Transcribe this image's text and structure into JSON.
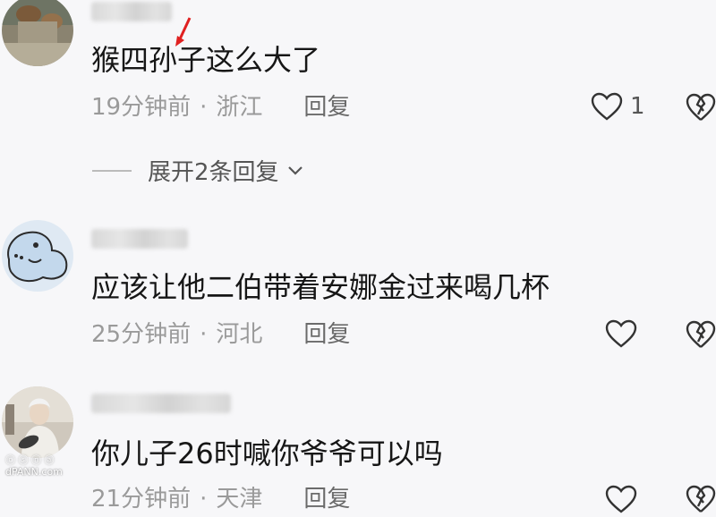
{
  "comments": [
    {
      "text": "猴四孙子这么大了",
      "time": "19分钟前",
      "separator": "·",
      "region": "浙江",
      "reply_label": "回复",
      "like_count": "1",
      "expand_label": "展开2条回复"
    },
    {
      "text": "应该让他二伯带着安娜金过来喝几杯",
      "time": "25分钟前",
      "separator": "·",
      "region": "河北",
      "reply_label": "回复"
    },
    {
      "text": "你儿子26时喊你爷爷可以吗",
      "time": "21分钟前",
      "separator": "·",
      "region": "天津",
      "reply_label": "回复"
    }
  ],
  "watermark": "ⓒ ⓢ ⓝ ⓐ\ndPANN.com",
  "colors": {
    "annotation_arrow": "#e02020",
    "meta_text": "#9a9a9a",
    "background": "#f7f7f9"
  },
  "icons": {
    "like": "heart-outline-icon",
    "dislike": "broken-heart-icon",
    "expand": "chevron-down-icon"
  }
}
